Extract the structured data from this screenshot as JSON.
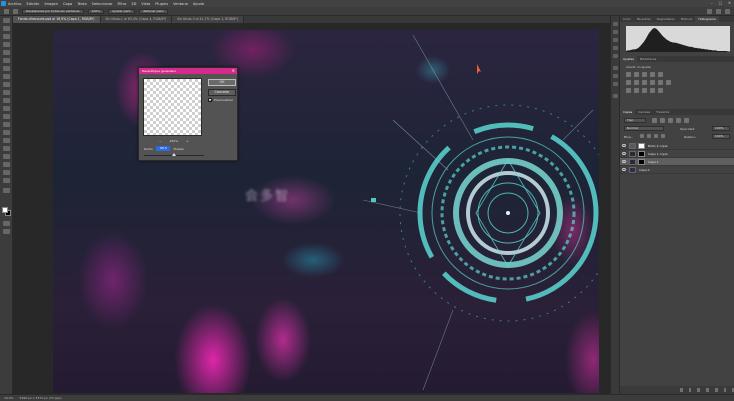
{
  "menubar": {
    "items": [
      "Archivo",
      "Edición",
      "Imagen",
      "Capa",
      "Texto",
      "Seleccionar",
      "Filtro",
      "3D",
      "Vista",
      "Plugins",
      "Ventana",
      "Ayuda"
    ],
    "window_controls": [
      "–",
      "□",
      "✕"
    ]
  },
  "options_bar": {
    "scroll_all": "Desplazarse por todas las ventanas",
    "zoom": "100%",
    "fit_screen": "Ajustar pant.",
    "fill_screen": "Rellenar pant."
  },
  "tabs": [
    {
      "label": "Fondo ciberpunk.psd al 16,9% (Capa 1, RGB/8*)",
      "active": true
    },
    {
      "label": "Sin título-1 al 63,4% (Capa 4, RGB/8*)",
      "active": false
    },
    {
      "label": "Sin título-3 al 41,7% (Capa 1, RGB/8*)",
      "active": false
    }
  ],
  "image": {
    "sign_text": "会多智"
  },
  "status": {
    "zoom": "16,9%",
    "doc_size": "5996 px x 3372 px (72 ppp)"
  },
  "panels": {
    "top_tabs": [
      "Color",
      "Muestras",
      "Degradados",
      "Motivos",
      "Histograma"
    ],
    "top_active": "Histograma",
    "histogram": {
      "shape": [
        2,
        3,
        3,
        4,
        5,
        5,
        6,
        8,
        11,
        15,
        19,
        24,
        30,
        36,
        40,
        44,
        46,
        45,
        42,
        38,
        34,
        30,
        27,
        24,
        22,
        20,
        19,
        18,
        18,
        17,
        16,
        15,
        14,
        13,
        12,
        11,
        10,
        10,
        9,
        8,
        8,
        7,
        7,
        6,
        6,
        5,
        5,
        4,
        4,
        3,
        3,
        3,
        2,
        2,
        2,
        2,
        2,
        2,
        1,
        1
      ]
    },
    "adj_tabs": [
      "Ajustes",
      "Bibliotecas"
    ],
    "adj_label": "Añadir un ajuste",
    "layers_tabs": [
      "Capas",
      "Canales",
      "Trazados"
    ],
    "kind": "Tipo",
    "blend": "Normal",
    "opacity_label": "Opacidad:",
    "opacity": "100%",
    "lock_label": "Bloq.:",
    "fill_label": "Relleno:",
    "fill": "100%",
    "layers": [
      {
        "name": "Brillo 2 copia",
        "selected": false,
        "mask": false
      },
      {
        "name": "Capa 1 copia",
        "selected": false,
        "mask": true
      },
      {
        "name": "Capa 1",
        "selected": true,
        "mask": true
      },
      {
        "name": "Capa 0",
        "selected": false,
        "mask": false
      }
    ]
  },
  "dialog": {
    "title": "Desenfoque gaussiano",
    "close": "✕",
    "ok": "OK",
    "cancel": "Cancelar",
    "preview_label": "Previsualizar",
    "zoom_out": "−",
    "zoom": "100%",
    "zoom_in": "+",
    "radius_label": "Radio:",
    "radius_value": "65,5",
    "radius_unit": "Píxeles"
  }
}
